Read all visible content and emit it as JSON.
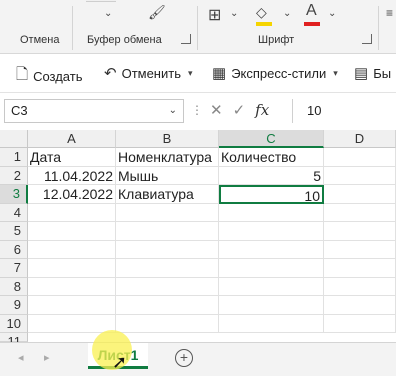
{
  "ribbon": {
    "undo_label": "Отмена",
    "clipboard_label": "Буфер обмена",
    "font_label": "Шрифт",
    "accent_color": "#107c41",
    "highlight_color": "#f5d400",
    "font_color": "#e02020"
  },
  "commands": {
    "create": "Создать",
    "undo": "Отменить",
    "styles": "Экспресс-стили",
    "truncated": "Бы"
  },
  "formula_bar": {
    "name_box": "C3",
    "value": "10",
    "fx": "fx"
  },
  "grid": {
    "columns": [
      "A",
      "B",
      "C",
      "D"
    ],
    "rows": [
      "1",
      "2",
      "3",
      "4",
      "5",
      "6",
      "7",
      "8",
      "9",
      "10",
      "11"
    ],
    "cells": {
      "A1": "Дата",
      "B1": "Номенклатура",
      "C1": "Количество",
      "A2": "11.04.2022",
      "B2": "Мышь",
      "C2": "5",
      "A3": "12.04.2022",
      "B3": "Клавиатура",
      "C3": "10"
    },
    "active_cell": "C3"
  },
  "sheets": {
    "tabs": [
      "Лист1"
    ],
    "add_icon": "+"
  }
}
